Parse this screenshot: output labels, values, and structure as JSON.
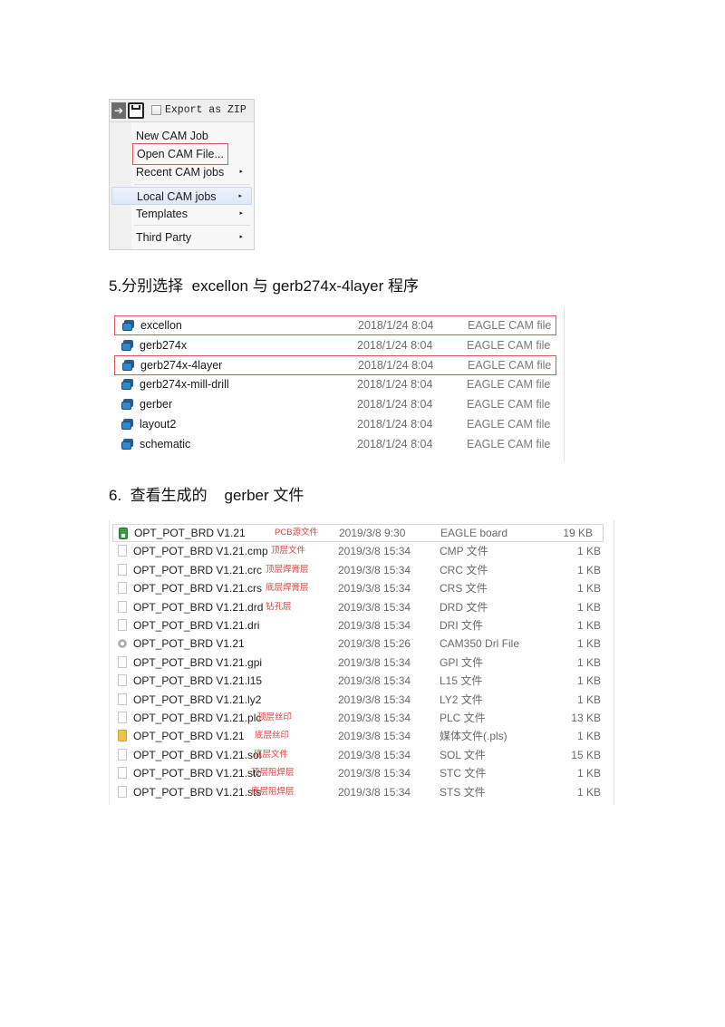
{
  "cam_menu": {
    "toolbar": {
      "arrow_icon": "arrow-right-icon",
      "save_icon": "save-icon",
      "export_zip_label": "Export as ZIP",
      "export_zip_checked": false
    },
    "items": [
      {
        "label": "New CAM Job",
        "submenu": false
      },
      {
        "label": "Open CAM File...",
        "submenu": false,
        "annotated_box": true
      },
      {
        "label": "Recent CAM jobs",
        "submenu": true,
        "arrow": "▸"
      },
      {
        "label": "Local CAM jobs",
        "submenu": true,
        "arrow": "▸",
        "highlighted": true
      },
      {
        "label": "Templates",
        "submenu": true,
        "arrow": "▸"
      },
      {
        "label": "Third Party",
        "submenu": true,
        "arrow": "▸"
      }
    ]
  },
  "step5": {
    "heading": "5.分别选择  excellon 与 gerb274x-4layer 程序"
  },
  "cam_files": {
    "rows": [
      {
        "name": "excellon",
        "date": "2018/1/24 8:04",
        "type": "EAGLE CAM file",
        "annotated_box": true
      },
      {
        "name": "gerb274x",
        "date": "2018/1/24 8:04",
        "type": "EAGLE CAM file"
      },
      {
        "name": "gerb274x-4layer",
        "date": "2018/1/24 8:04",
        "type": "EAGLE CAM file",
        "annotated_box": true
      },
      {
        "name": "gerb274x-mill-drill",
        "date": "2018/1/24 8:04",
        "type": "EAGLE CAM file"
      },
      {
        "name": "gerber",
        "date": "2018/1/24 8:04",
        "type": "EAGLE CAM file"
      },
      {
        "name": "layout2",
        "date": "2018/1/24 8:04",
        "type": "EAGLE CAM file"
      },
      {
        "name": "schematic",
        "date": "2018/1/24 8:04",
        "type": "EAGLE CAM file"
      }
    ]
  },
  "step6": {
    "heading": "6.  查看生成的    gerber 文件"
  },
  "gerber_files": {
    "annotation_color": "#e0403c",
    "rows": [
      {
        "name": "OPT_POT_BRD V1.21",
        "note": "PCB源文件",
        "date": "2019/3/8 9:30",
        "type": "EAGLE board",
        "size": "19 KB",
        "icon": "eagle-board-icon"
      },
      {
        "name": "OPT_POT_BRD V1.21.cmp",
        "note": "顶层文件",
        "date": "2019/3/8 15:34",
        "type": "CMP 文件",
        "size": "1 KB",
        "icon": "file-icon"
      },
      {
        "name": "OPT_POT_BRD V1.21.crc",
        "note": "顶层焊膏层",
        "date": "2019/3/8 15:34",
        "type": "CRC 文件",
        "size": "1 KB",
        "icon": "file-icon"
      },
      {
        "name": "OPT_POT_BRD V1.21.crs",
        "note": "底层焊膏层",
        "date": "2019/3/8 15:34",
        "type": "CRS 文件",
        "size": "1 KB",
        "icon": "file-icon"
      },
      {
        "name": "OPT_POT_BRD V1.21.drd",
        "note": "钻孔层",
        "date": "2019/3/8 15:34",
        "type": "DRD 文件",
        "size": "1 KB",
        "icon": "file-icon"
      },
      {
        "name": "OPT_POT_BRD V1.21.dri",
        "note": "",
        "date": "2019/3/8 15:34",
        "type": "DRI 文件",
        "size": "1 KB",
        "icon": "file-icon"
      },
      {
        "name": "OPT_POT_BRD V1.21",
        "note": "",
        "date": "2019/3/8 15:26",
        "type": "CAM350 Drl File",
        "size": "1 KB",
        "icon": "cam350-icon"
      },
      {
        "name": "OPT_POT_BRD V1.21.gpi",
        "note": "",
        "date": "2019/3/8 15:34",
        "type": "GPI 文件",
        "size": "1 KB",
        "icon": "file-icon"
      },
      {
        "name": "OPT_POT_BRD V1.21.l15",
        "note": "",
        "date": "2019/3/8 15:34",
        "type": "L15 文件",
        "size": "1 KB",
        "icon": "file-icon"
      },
      {
        "name": "OPT_POT_BRD V1.21.ly2",
        "note": "",
        "date": "2019/3/8 15:34",
        "type": "LY2 文件",
        "size": "1 KB",
        "icon": "file-icon"
      },
      {
        "name": "OPT_POT_BRD V1.21.plc",
        "note": "顶层丝印",
        "date": "2019/3/8 15:34",
        "type": "PLC 文件",
        "size": "13 KB",
        "icon": "file-icon"
      },
      {
        "name": "OPT_POT_BRD V1.21",
        "note": "底层丝印",
        "date": "2019/3/8 15:34",
        "type": "媒体文件(.pls)",
        "size": "1 KB",
        "icon": "media-file-icon"
      },
      {
        "name": "OPT_POT_BRD V1.21.sol",
        "note": "底层文件",
        "date": "2019/3/8 15:34",
        "type": "SOL 文件",
        "size": "15 KB",
        "icon": "file-icon"
      },
      {
        "name": "OPT_POT_BRD V1.21.stc",
        "note": "顶层阻焊层",
        "date": "2019/3/8 15:34",
        "type": "STC 文件",
        "size": "1 KB",
        "icon": "file-icon"
      },
      {
        "name": "OPT_POT_BRD V1.21.sts",
        "note": "底层阻焊层",
        "date": "2019/3/8 15:34",
        "type": "STS 文件",
        "size": "1 KB",
        "icon": "file-icon"
      }
    ]
  }
}
